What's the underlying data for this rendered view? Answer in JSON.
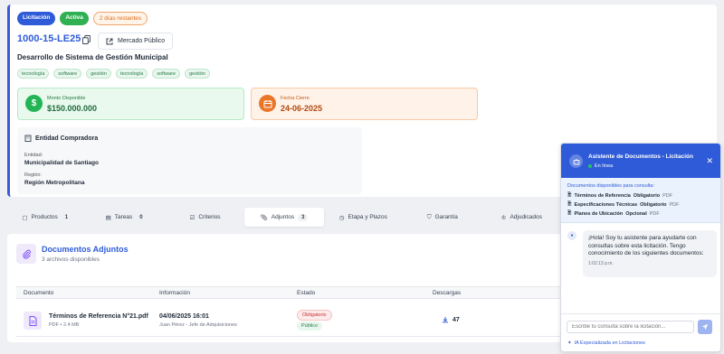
{
  "header": {
    "badges": {
      "licitacion": "Licitación",
      "activa": "Activa",
      "days_left": "2 días restantes"
    },
    "code": "1000-15-LE25",
    "mercado_button": "Mercado Público",
    "title": "Desarrollo de Sistema de Gestión Municipal",
    "tags": [
      "tecnología",
      "software",
      "gestión",
      "tecnología",
      "software",
      "gestión"
    ]
  },
  "amount": {
    "label": "Monto Disponible",
    "value": "$150.000.000",
    "color": "#22b455"
  },
  "closing": {
    "label": "Fecha Cierre",
    "value": "24-06-2025",
    "color": "#e9772a"
  },
  "entity": {
    "heading": "Entidad Compradora",
    "entity_label": "Entidad:",
    "entity_value": "Municipalidad de Santiago",
    "region_label": "Región:",
    "region_value": "Región Metropolitana"
  },
  "tabs": [
    {
      "label": "Productos",
      "count": "1"
    },
    {
      "label": "Tareas",
      "count": "0"
    },
    {
      "label": "Criterios",
      "count": ""
    },
    {
      "label": "Adjuntos",
      "count": "3",
      "active": true
    },
    {
      "label": "Etapa y Plazos",
      "count": ""
    },
    {
      "label": "Garantía",
      "count": ""
    },
    {
      "label": "Adjudicados",
      "count": ""
    }
  ],
  "documents": {
    "title": "Documentos Adjuntos",
    "subtitle": "3 archivos disponibles",
    "columns": {
      "document": "Documento",
      "info": "Información",
      "status": "Estado",
      "downloads": "Descargas"
    },
    "rows": [
      {
        "name": "Términos de Referencia N°21.pdf",
        "meta": "PDF • 2.4 MB",
        "date": "04/06/2025 16:01",
        "author": "Juan Pérez - Jefe de Adquisiciones",
        "status_required": "Obligatorio",
        "status_public": "Público",
        "downloads": "47"
      }
    ]
  },
  "chat": {
    "title": "Asistente de Documentos - Licitación",
    "status": "En línea",
    "docs_heading": "Documentos disponibles para consulta:",
    "docs": [
      {
        "name": "Términos de Referencia",
        "req": "Obligatorio",
        "type": "PDF"
      },
      {
        "name": "Especificaciones Técnicas",
        "req": "Obligatorio",
        "type": "PDF"
      },
      {
        "name": "Planos de Ubicación",
        "req": "Opcional",
        "type": "PDF"
      }
    ],
    "message": "¡Hola! Soy tu asistente para ayudarte con consultas sobre esta licitación. Tengo conocimiento de los siguientes documentos:",
    "message_time": "1:02:13 p.m.",
    "input_placeholder": "Escribe tu consulta sobre la licitación...",
    "footer": "IA Especializada en Licitaciones"
  }
}
